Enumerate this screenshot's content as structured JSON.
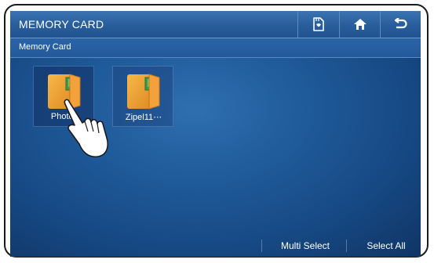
{
  "header": {
    "title": "MEMORY CARD"
  },
  "toolbar": {
    "buttons": [
      {
        "name": "storage-icon"
      },
      {
        "name": "home-icon"
      },
      {
        "name": "back-icon"
      }
    ]
  },
  "breadcrumb": {
    "path": "Memory Card"
  },
  "folders": [
    {
      "label": "Photos",
      "selected": true
    },
    {
      "label": "Zipel11⋯",
      "selected": false
    }
  ],
  "footer": {
    "multi_select_label": "Multi Select",
    "select_all_label": "Select All"
  },
  "colors": {
    "background": "#1f5a9a",
    "titlebar": "#2a5f9d",
    "folder_orange": "#f0a33a",
    "text": "#ffffff"
  }
}
